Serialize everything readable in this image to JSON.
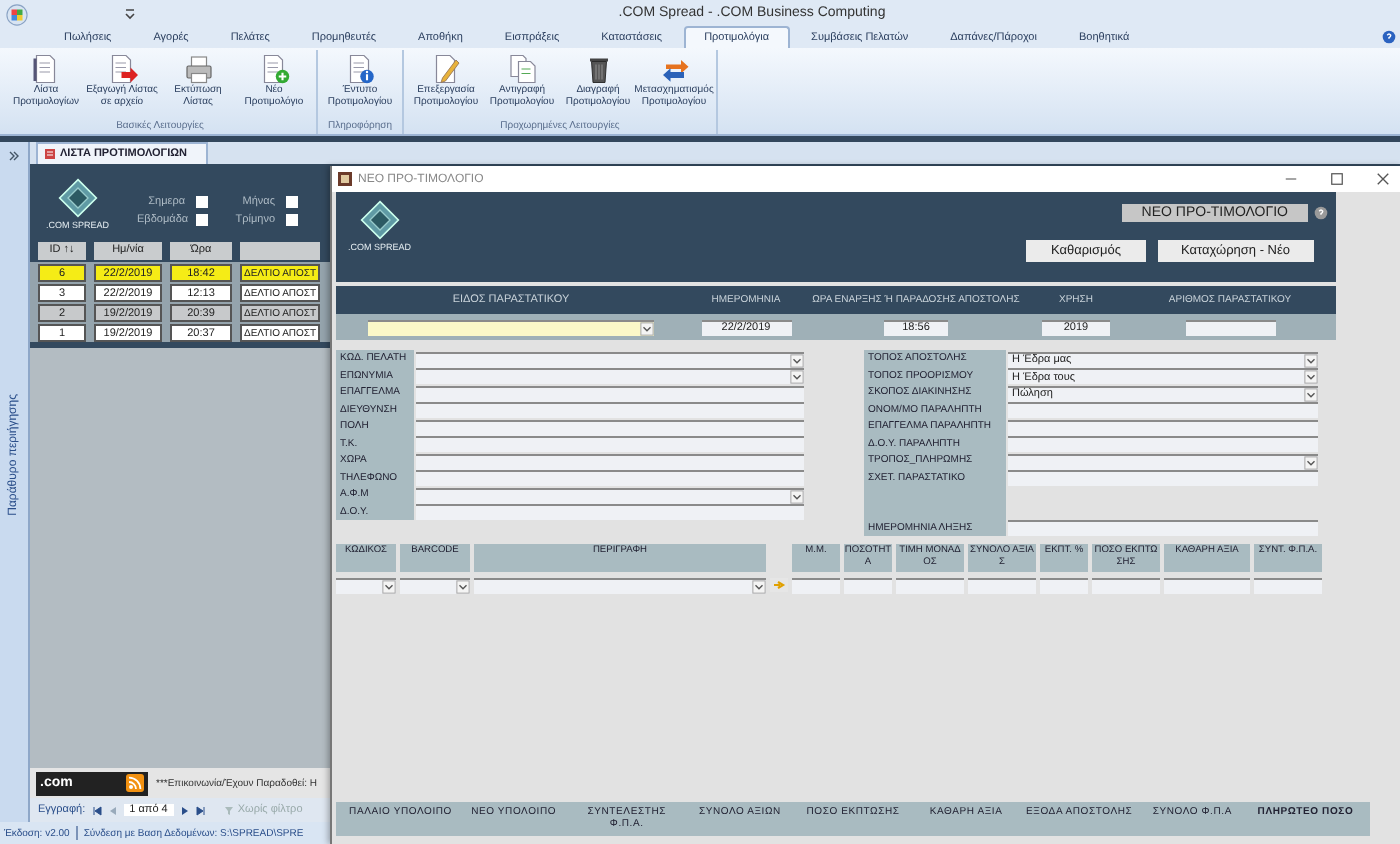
{
  "window": {
    "title": ".COM Spread - .COM Business Computing"
  },
  "tabs": [
    {
      "label": "Πωλήσεις",
      "selected": false
    },
    {
      "label": "Αγορές",
      "selected": false
    },
    {
      "label": "Πελάτες",
      "selected": false
    },
    {
      "label": "Προμηθευτές",
      "selected": false
    },
    {
      "label": "Αποθήκη",
      "selected": false
    },
    {
      "label": "Εισπράξεις",
      "selected": false
    },
    {
      "label": "Καταστάσεις",
      "selected": false
    },
    {
      "label": "Προτιμολόγια",
      "selected": true
    },
    {
      "label": "Συμβάσεις Πελατών",
      "selected": false
    },
    {
      "label": "Δαπάνες/Πάροχοι",
      "selected": false
    },
    {
      "label": "Βοηθητικά",
      "selected": false
    }
  ],
  "ribbon": {
    "groups": [
      {
        "label": "Βασικές Λειτουργίες",
        "buttons": [
          "Λίστα Προτιμολογίων",
          "Εξαγωγή Λίστας σε αρχείο",
          "Εκτύπωση Λίστας",
          "Νέο Προτιμολόγιο"
        ]
      },
      {
        "label": "Πληροφόρηση",
        "buttons": [
          "Έντυπο Προτιμολογίου"
        ]
      },
      {
        "label": "Προχωρημένες Λειτουργίες",
        "buttons": [
          "Επεξεργασία Προτιμολογίου",
          "Αντιγραφή Προτιμολογίου",
          "Διαγραφή Προτιμολογίου",
          "Μετασχηματισμός Προτιμολογίου"
        ]
      }
    ]
  },
  "navigation_pane": {
    "label": "Παράθυρο περιήγησης"
  },
  "document_tab": {
    "label": "ΛΙΣΤΑ ΠΡΟΤΙΜΟΛΟΓΙΩΝ"
  },
  "list": {
    "logo_text": ".COM SPREAD",
    "filters": [
      {
        "label": "Σημερα",
        "checked": false
      },
      {
        "label": "Μήνας",
        "checked": false
      },
      {
        "label": "Εβδομάδα",
        "checked": false
      },
      {
        "label": "Τρίμηνο",
        "checked": false
      }
    ],
    "columns": [
      "ID ↑↓",
      "Ημ/νία",
      "Ώρα"
    ],
    "rows": [
      {
        "id": "6",
        "date": "22/2/2019",
        "time": "18:42",
        "type": "ΔΕΛΤΙΟ ΑΠΟΣΤ",
        "selected": true
      },
      {
        "id": "3",
        "date": "22/2/2019",
        "time": "12:13",
        "type": "ΔΕΛΤΙΟ ΑΠΟΣΤ",
        "selected": false
      },
      {
        "id": "2",
        "date": "19/2/2019",
        "time": "20:39",
        "type": "ΔΕΛΤΙΟ ΑΠΟΣΤ",
        "selected": false
      },
      {
        "id": "1",
        "date": "19/2/2019",
        "time": "20:37",
        "type": "ΔΕΛΤΙΟ ΑΠΟΣΤ",
        "selected": false
      }
    ]
  },
  "banner": {
    "logo_text": ".com",
    "message": "***Επικοινωνία/Έχουν Παραδοθεί: Η"
  },
  "record_nav": {
    "label": "Εγγραφή:",
    "position": "1 από 4",
    "filter": "Χωρίς φίλτρο"
  },
  "status_bar": {
    "version": "Έκδοση: v2.00",
    "connection": "Σύνδεση με Βαση Δεδομένων: S:\\SPREAD\\SPRE"
  },
  "dialog": {
    "title": "ΝΕΟ ΠΡΟ-ΤΙΜΟΛΟΓΙΟ",
    "logo_text": ".COM SPREAD",
    "heading": "ΝΕΟ ΠΡΟ-ΤΙΜΟΛΟΓΙΟ",
    "buttons": [
      "Καθαρισμός",
      "Καταχώρηση - Νέο"
    ],
    "header_fields": [
      {
        "label": "ΕΙΔΟΣ ΠΑΡΑΣΤΑΤΙΚΟΥ",
        "kind": "combo"
      },
      {
        "label": "ΗΜΕΡΟΜΗΝΙΑ",
        "kind": "text",
        "value": "22/2/2019"
      },
      {
        "label": "ΩΡΑ ΕΝΑΡΞΗΣ Ή ΠΑΡΑΔΟΣΗΣ ΑΠΟΣΤΟΛΗΣ",
        "kind": "text",
        "value": "18:56"
      },
      {
        "label": "ΧΡΗΣΗ",
        "kind": "text",
        "value": "2019"
      },
      {
        "label": "ΑΡΙΘΜΟΣ ΠΑΡΑΣΤΑΤΙΚΟΥ",
        "kind": "text"
      }
    ],
    "customer_fields": [
      {
        "label": "ΚΩΔ. ΠΕΛΑΤΗ",
        "kind": "combo"
      },
      {
        "label": "ΕΠΩΝΥΜΙΑ",
        "kind": "combo"
      },
      {
        "label": "ΕΠΑΓΓΕΛΜΑ",
        "kind": "text"
      },
      {
        "label": "ΔΙΕΥΘΥΝΣΗ",
        "kind": "text"
      },
      {
        "label": "ΠΟΛΗ",
        "kind": "text"
      },
      {
        "label": "Τ.Κ.",
        "kind": "text"
      },
      {
        "label": "ΧΩΡΑ",
        "kind": "text"
      },
      {
        "label": "ΤΗΛΕΦΩΝΟ",
        "kind": "text"
      },
      {
        "label": "Α.Φ.Μ",
        "kind": "combo"
      },
      {
        "label": "Δ.Ο.Υ.",
        "kind": "text"
      }
    ],
    "shipping_fields": [
      {
        "label": "ΤΟΠΟΣ ΑΠΟΣΤΟΛΗΣ",
        "kind": "combo",
        "value": "Η Έδρα μας"
      },
      {
        "label": "ΤΟΠΟΣ ΠΡΟΟΡΙΣΜΟΥ",
        "kind": "combo",
        "value": "Η Έδρα τους"
      },
      {
        "label": "ΣΚΟΠΟΣ ΔΙΑΚΙΝΗΣΗΣ",
        "kind": "combo",
        "value": "Πώληση"
      },
      {
        "label": "ΟΝΟΜ/ΜΟ ΠΑΡΑΛΗΠΤΗ",
        "kind": "text"
      },
      {
        "label": "ΕΠΑΓΓΕΛΜΑ ΠΑΡΑΛΗΠΤΗ",
        "kind": "text"
      },
      {
        "label": "Δ.Ο.Υ. ΠΑΡΑΛΗΠΤΗ",
        "kind": "text"
      },
      {
        "label": "ΤΡΟΠΟΣ_ΠΛΗΡΩΜΗΣ",
        "kind": "combo"
      },
      {
        "label": "ΣΧΕΤ. ΠΑΡΑΣΤΑΤΙΚΟ",
        "kind": "tall"
      },
      {
        "label": "ΗΜΕΡΟΜΗΝΙΑ ΛΗΞΗΣ",
        "kind": "text"
      }
    ],
    "item_columns": [
      {
        "label": "ΚΩΔΙΚΟΣ",
        "kind": "combo"
      },
      {
        "label": "BARCODE",
        "kind": "combo"
      },
      {
        "label": "ΠΕΡΙΓΡΑΦΗ",
        "kind": "combo"
      },
      {
        "kind": "arrow"
      },
      {
        "label": "Μ.Μ.",
        "kind": "text"
      },
      {
        "label": "ΠΟΣΟΤΗΤΑ",
        "kind": "text"
      },
      {
        "label": "ΤΙΜΗ ΜΟΝΑΔΟΣ",
        "kind": "text"
      },
      {
        "label": "ΣΥΝΟΛΟ ΑΞΙΑΣ",
        "kind": "text"
      },
      {
        "label": "ΕΚΠΤ. %",
        "kind": "text"
      },
      {
        "label": "ΠΟΣΟ ΕΚΠΤΩΣΗΣ",
        "kind": "text"
      },
      {
        "label": "ΚΑΘΑΡΗ ΑΞΙΑ",
        "kind": "text"
      },
      {
        "label": "ΣΥΝΤ. Φ.Π.Α.",
        "kind": "text"
      }
    ],
    "totals": [
      {
        "label": "ΠΑΛΑΙΟ ΥΠΟΛΟΙΠΟ",
        "bold": false
      },
      {
        "label": "ΝΕΟ ΥΠΟΛΟΙΠΟ",
        "bold": false
      },
      {
        "label": "ΣΥΝΤΕΛΕΣΤΗΣ Φ.Π.Α.",
        "bold": false
      },
      {
        "label": "ΣΥΝΟΛΟ ΑΞΙΩΝ",
        "bold": false
      },
      {
        "label": "ΠΟΣΟ ΕΚΠΤΩΣΗΣ",
        "bold": false
      },
      {
        "label": "ΚΑΘΑΡΗ ΑΞΙΑ",
        "bold": false
      },
      {
        "label": "ΕΞΟΔΑ ΑΠΟΣΤΟΛΗΣ",
        "bold": false
      },
      {
        "label": "ΣΥΝΟΛΟ Φ.Π.Α",
        "bold": false
      },
      {
        "label": "ΠΛΗΡΩΤΕΟ ΠΟΣΟ",
        "bold": true
      }
    ]
  }
}
